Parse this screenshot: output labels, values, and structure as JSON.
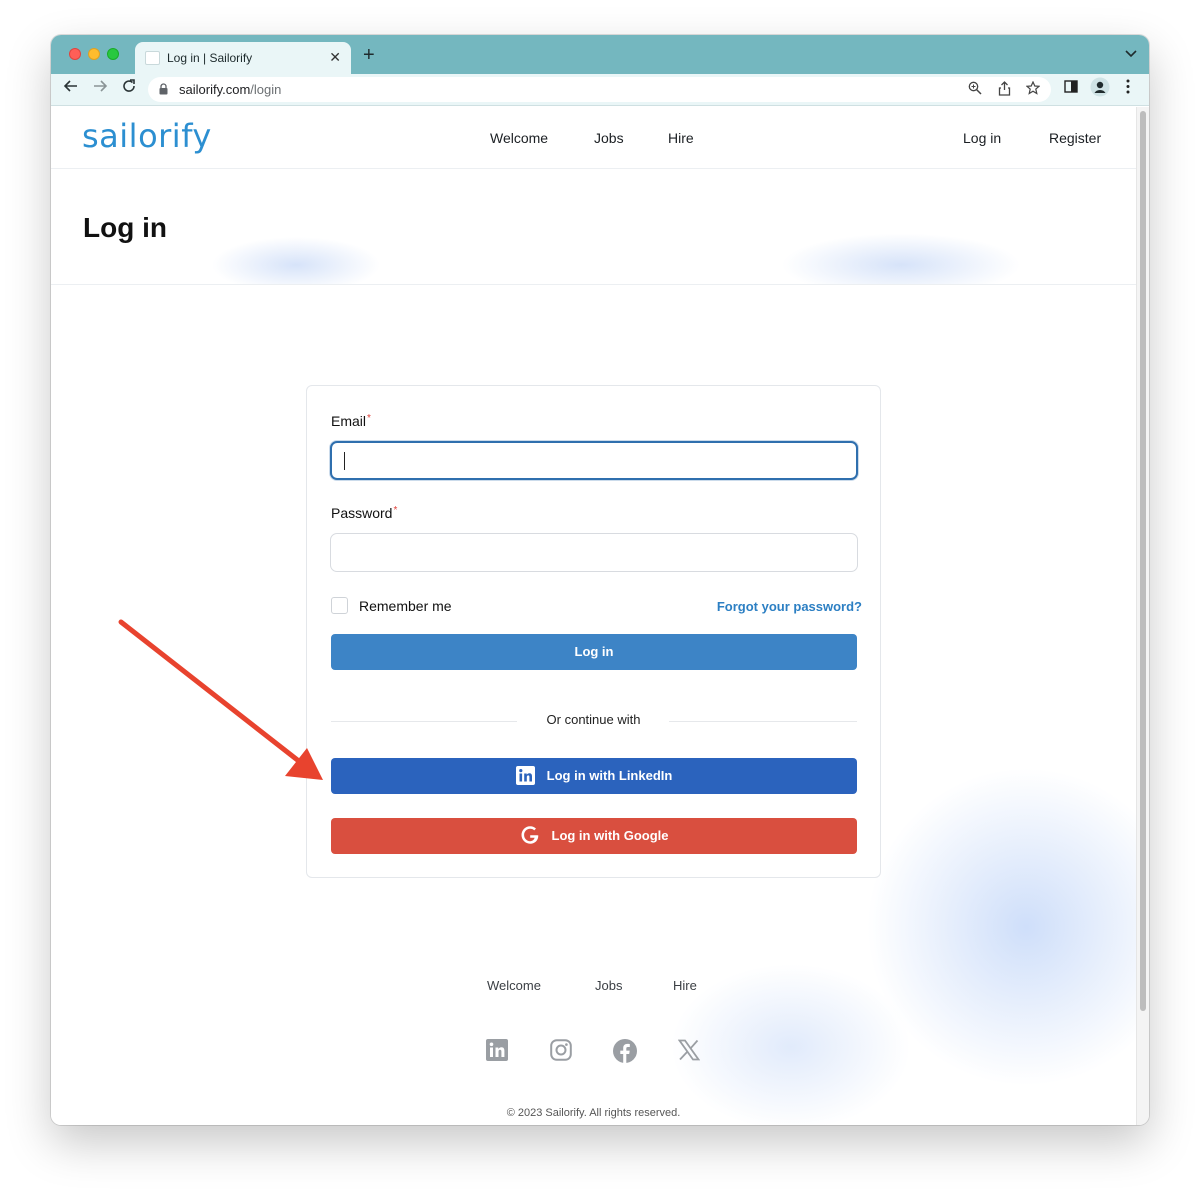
{
  "browser": {
    "tab_title": "Log in | Sailorify",
    "url_host": "sailorify.com",
    "url_path": "/login"
  },
  "site": {
    "logo": "sailorify",
    "nav": [
      "Welcome",
      "Jobs",
      "Hire"
    ],
    "login_link": "Log in",
    "register_link": "Register"
  },
  "hero": {
    "title": "Log in"
  },
  "form": {
    "email_label": "Email",
    "password_label": "Password",
    "required_mark": "*",
    "email_value": "",
    "password_value": "",
    "remember_label": "Remember me",
    "forgot_label": "Forgot your password?",
    "login_button": "Log in",
    "divider": "Or continue with",
    "linkedin_button": "Log in with LinkedIn",
    "google_button": "Log in with Google"
  },
  "footer": {
    "links": [
      "Welcome",
      "Jobs",
      "Hire"
    ],
    "social_icons": [
      "linkedin-icon",
      "instagram-icon",
      "facebook-icon",
      "x-icon"
    ],
    "copyright": "© 2023 Sailorify. All rights reserved."
  },
  "colors": {
    "brand": "#2c8fd1",
    "primary_button": "#3d84c6",
    "linkedin": "#2b63bd",
    "google": "#d94f3f",
    "annotation_arrow": "#e8432e",
    "chrome_frame": "#74b7bf"
  }
}
